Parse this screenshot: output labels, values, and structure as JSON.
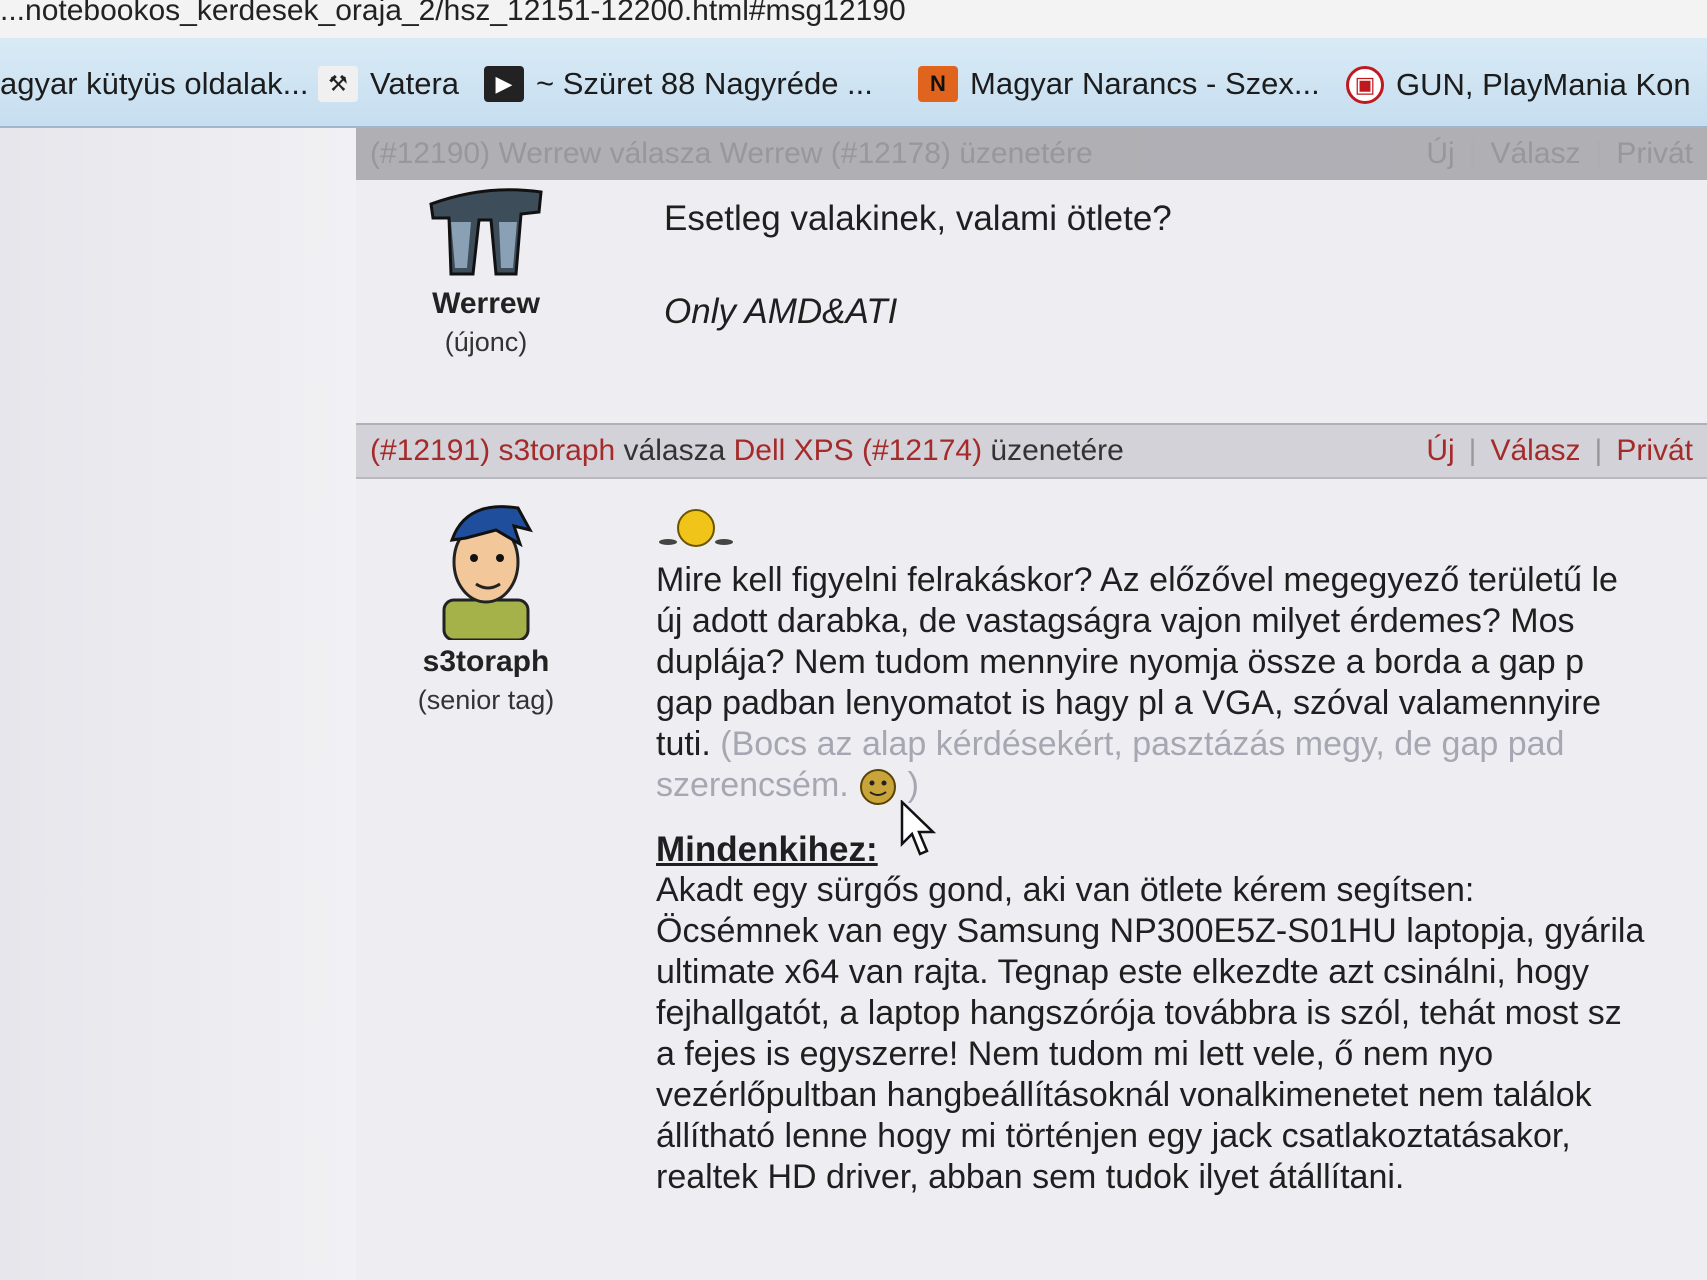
{
  "url_fragment": "...notebookos_kerdesek_oraja_2/hsz_12151-12200.html#msg12190",
  "bookmarks": [
    {
      "label": "agyar kütyüs oldalak...",
      "icon": "none"
    },
    {
      "label": "Vatera",
      "icon": "hammer-icon"
    },
    {
      "label": "~ Szüret 88 Nagyréde ...",
      "icon": "youtube-icon"
    },
    {
      "label": "Magyar Narancs - Szex...",
      "icon": "n-logo-icon"
    },
    {
      "label": "GUN, PlayMania Kon",
      "icon": "gamepad-icon"
    }
  ],
  "posts": [
    {
      "header": {
        "number": "(#12190)",
        "author": "Werrew",
        "reply_word": "válasza",
        "target": "Werrew",
        "target_number": "(#12178)",
        "suffix": "üzenetére"
      },
      "actions": [
        "Új",
        "Válasz",
        "Privát"
      ],
      "user": {
        "name": "Werrew",
        "rank": "(újonc)"
      },
      "lines": [
        "Esetleg valakinek, valami ötlete?"
      ],
      "signature": "Only AMD&ATI"
    },
    {
      "header": {
        "number": "(#12191)",
        "author": "s3toraph",
        "reply_word": "válasza",
        "target": "Dell XPS",
        "target_number": "(#12174)",
        "suffix": "üzenetére"
      },
      "actions": [
        "Új",
        "Válasz",
        "Privát"
      ],
      "user": {
        "name": "s3toraph",
        "rank": "(senior tag)"
      },
      "paragraph1": [
        "Mire kell figyelni felrakáskor? Az előzővel megegyező területű le",
        "új adott darabka, de vastagságra vajon milyet érdemes? Mos",
        "duplája? Nem tudom mennyire nyomja össze a borda a gap p",
        "gap padban lenyomatot is hagy pl a VGA, szóval valamennyire",
        "tuti."
      ],
      "faded": [
        "(Bocs az alap kérdésekért, pasztázás megy, de gap pad",
        "szerencsém."
      ],
      "section_heading": "Mindenkihez:",
      "paragraph2": [
        "Akadt egy sürgős gond, aki van ötlete kérem segítsen:",
        "Öcsémnek van egy Samsung NP300E5Z-S01HU laptopja, gyárila",
        "ultimate x64 van rajta. Tegnap este elkezdte azt csinálni, hogy",
        "fejhallgatót, a laptop hangszórója továbbra is szól, tehát most sz",
        "a fejes is egyszerre! Nem tudom mi lett vele, ő nem nyo",
        "vezérlőpultban hangbeállításoknál vonalkimenetet nem találok",
        "állítható lenne hogy mi történjen egy jack csatlakoztatásakor,",
        "realtek HD driver, abban sem tudok ilyet átállítani."
      ]
    }
  ]
}
